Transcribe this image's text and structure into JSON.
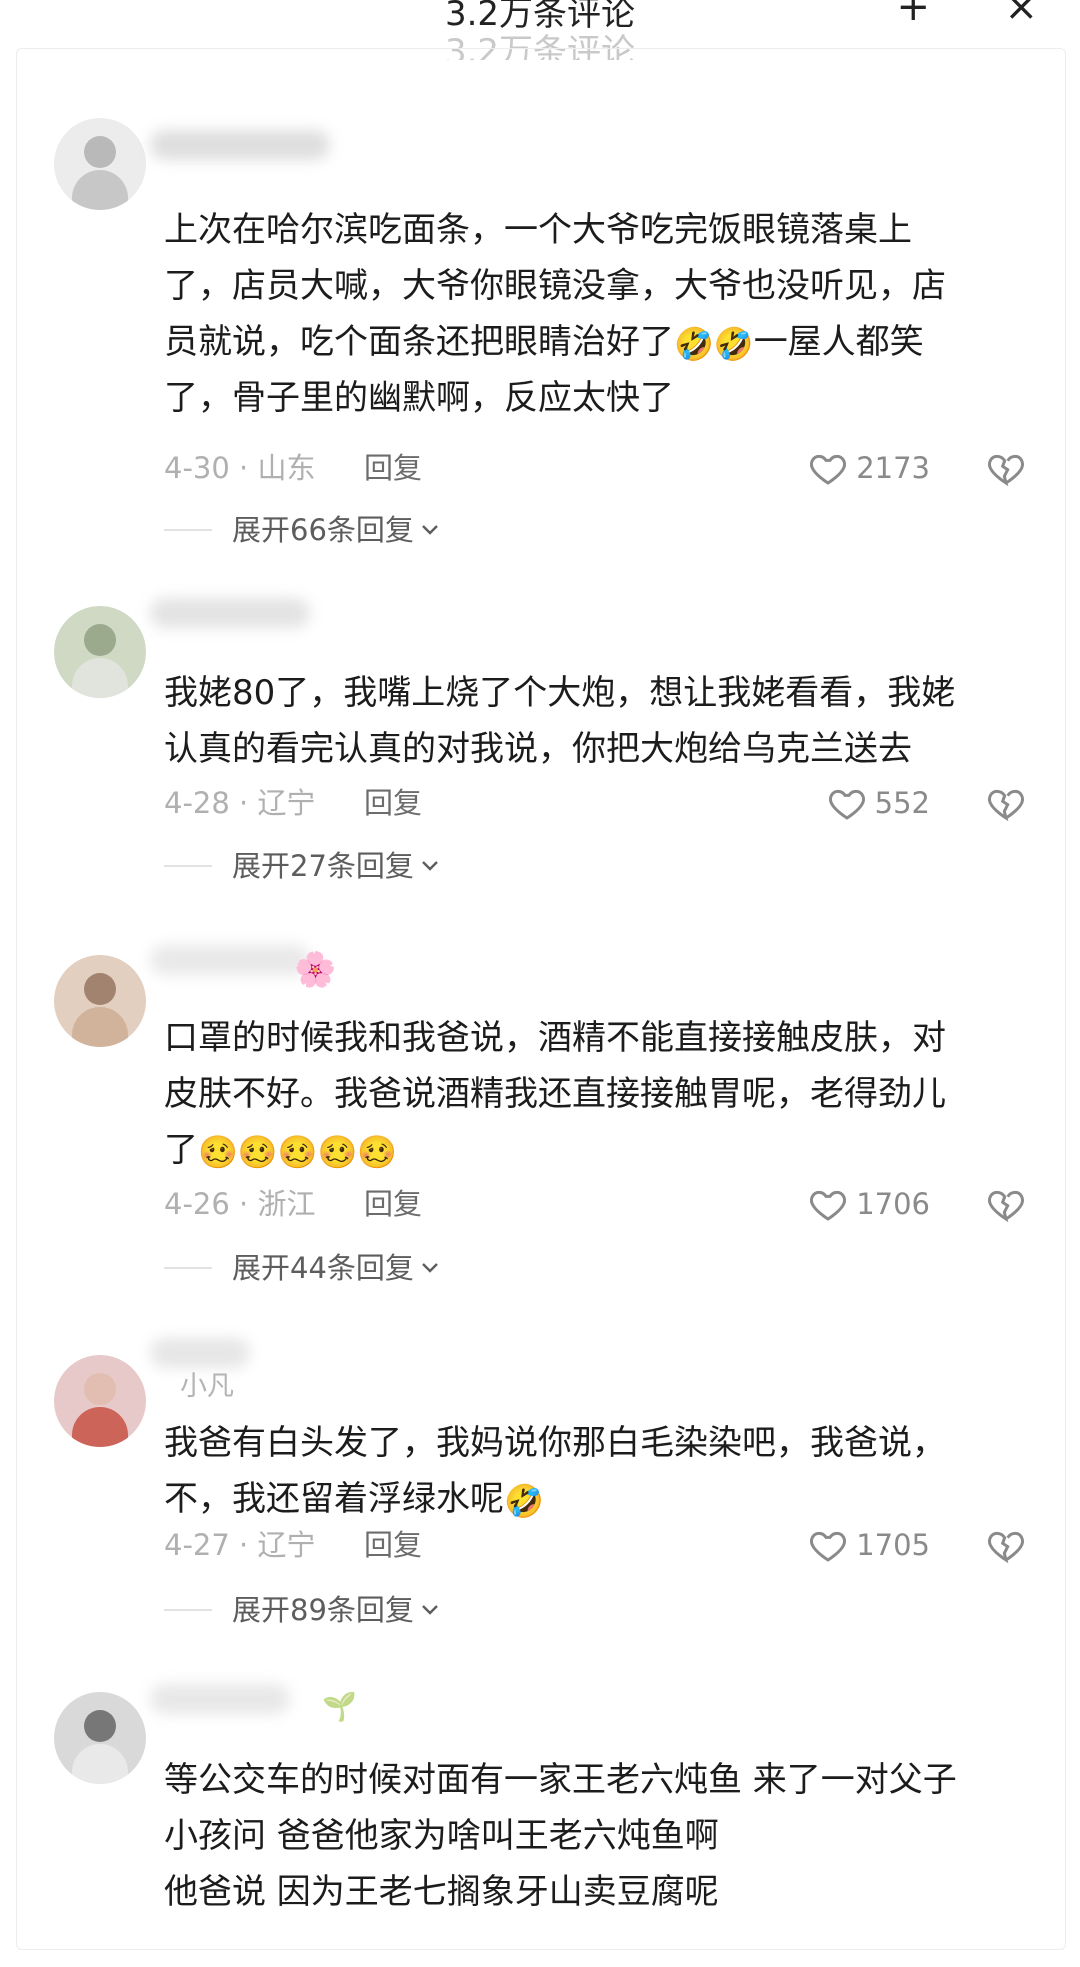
{
  "header": {
    "title": "3.2万条评论",
    "add_icon": "+",
    "close_icon": "×"
  },
  "comments": [
    {
      "avatar": {
        "icon": "avatar-figure",
        "bg": "#dcdcdc",
        "fg": "#9a9a9a"
      },
      "lines": [
        "上次在哈尔滨吃面条，一个大爷吃完饭眼镜落桌上",
        "了，店员大喊，大爷你眼镜没拿，大爷也没听见，店",
        {
          "before": "员就说，吃个面条还把眼睛治好了",
          "emoji": [
            "🤣",
            "🤣"
          ],
          "after": "一屋人都笑"
        },
        "了，骨子里的幽默啊，反应太快了"
      ],
      "date": "4-30 · 山东",
      "reply": "回复",
      "likes": "2173",
      "expand": "展开66条回复"
    },
    {
      "avatar": {
        "icon": "avatar-figure",
        "bg": "#cfd9c4",
        "fg": "#7a8a6a"
      },
      "lines": [
        "我姥80了，我嘴上烧了个大炮，想让我姥看看，我姥",
        "认真的看完认真的对我说，你把大炮给乌克兰送去"
      ],
      "date": "4-28 · 辽宁",
      "reply": "回复",
      "likes": "552",
      "expand": "展开27条回复"
    },
    {
      "avatar": {
        "icon": "avatar-figure",
        "bg": "#e3cfc0",
        "fg": "#8b6a55"
      },
      "username_deco": "🌸",
      "lines": [
        "口罩的时候我和我爸说，酒精不能直接接触皮肤，对",
        "皮肤不好。我爸说酒精我还直接接触胃呢，老得劲儿",
        {
          "before": "了",
          "emoji": [
            "🥴",
            "🥴",
            "🥴",
            "🥴",
            "🥴"
          ],
          "after": ""
        }
      ],
      "date": "4-26 · 浙江",
      "reply": "回复",
      "likes": "1706",
      "expand": "展开44条回复"
    },
    {
      "avatar": {
        "icon": "avatar-figure",
        "bg": "#e7c9c9",
        "fg": "#c0392b"
      },
      "username": "小凡",
      "lines": [
        "我爸有白头发了，我妈说你那白毛染染吧，我爸说，",
        {
          "before": "不，我还留着浮绿水呢",
          "emoji": [
            "🤣"
          ],
          "after": ""
        }
      ],
      "date": "4-27 · 辽宁",
      "reply": "回复",
      "likes": "1705",
      "expand": "展开89条回复"
    },
    {
      "avatar": {
        "icon": "avatar-figure",
        "bg": "#d9d9d9",
        "fg": "#555555"
      },
      "username_deco": "🌱",
      "lines": [
        "等公交车的时候对面有一家王老六炖鱼 来了一对父子",
        "小孩问 爸爸他家为啥叫王老六炖鱼啊",
        "他爸说 因为王老七搁象牙山卖豆腐呢"
      ]
    }
  ],
  "colors": {
    "text": "#1c1c1c",
    "meta": "#b0b0b0",
    "reply": "#6c6c6c",
    "expand": "#5d5d5d",
    "icon": "#8a8a8a"
  }
}
